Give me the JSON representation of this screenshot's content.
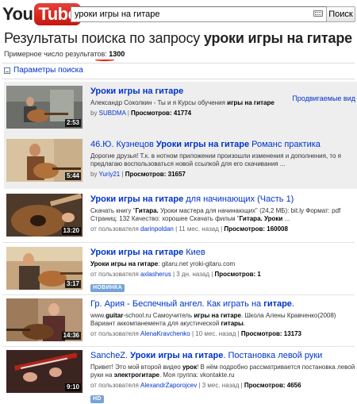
{
  "header": {
    "logo_you": "You",
    "logo_tube": "Tube",
    "search_value": "уроки игры на гитаре",
    "search_button": "Поиск"
  },
  "results": {
    "title_prefix": "Результаты поиска по запросу ",
    "query": "уроки игры на гитаре",
    "count_label": "Примерное число результатов: ",
    "count": "1300",
    "filter_label": "Параметры поиска",
    "promoted_label": "Продвигаемые вид"
  },
  "videos": [
    {
      "duration": "2:53",
      "title_a": "Уроки игры на гитаре",
      "title_b": "",
      "desc1_a": "Александр Соколкин - Ты и я Курсы обучения ",
      "desc1_b": "игры на гитаре",
      "desc2": "",
      "by_label": "by ",
      "user": "SUBDMA",
      "views_label": "Просмотров: 41774",
      "age": "",
      "badge": ""
    },
    {
      "duration": "5:44",
      "title_a": "46.Ю. Кузнецов ",
      "title_b": "Уроки игры на гитаре",
      "title_c": " Романс практика",
      "desc1": "Дорогие друзья! Т.к. в нотном приложении произошли изменения и дополнения, то я",
      "desc2": "предлагаю воспользоваться новой ссылкой для его скачивания ...",
      "by_label": "by ",
      "user": "Yuriy21",
      "views_label": "Просмотров: 31657"
    },
    {
      "duration": "13:20",
      "title_a": "Уроки игры на гитаре",
      "title_b": " для начинающих (Часть 1)",
      "desc1_a": "Скачать книгу \"",
      "desc1_b": "Гитара.",
      "desc1_c": " Уроки мастера для начинающих\" (24,2 МБ): bit.ly Формат: pdf",
      "desc2_a": "Страниц: 132 Качество: хорошее Скачать фильм \"",
      "desc2_b": "Гитара. Уроки",
      "desc2_c": " ...",
      "by_label": "от пользователя ",
      "user": "darinpoldan",
      "age": " | 11 мес. назад | ",
      "views_label": "Просмотров: 160008"
    },
    {
      "duration": "3:17",
      "title_a": "Уроки игры на гитаре",
      "title_b": " Киев",
      "desc1_a": "Уроки игры на гитаре",
      "desc1_b": ": gitaru.net yroki-gitaru.com",
      "by_label": "от пользователя ",
      "user": "axlasherus",
      "age": " | 3 дн. назад | ",
      "views_label": "Просмотров: 1",
      "badge": "НОВИНКА"
    },
    {
      "duration": "14:36",
      "title_a": "Гр. Ария - Беспечный ангел. Как играть на ",
      "title_b": "гитаре",
      "title_c": ".",
      "desc1_a": "www.",
      "desc1_b": "guitar",
      "desc1_c": "-school.ru Самоучитель ",
      "desc1_d": "игры на гитаре",
      "desc1_e": ". Школа Алены Кравченко(2008)",
      "desc2_a": "Вариант аккомпанемента для акустической ",
      "desc2_b": "гитары",
      "desc2_c": ".",
      "by_label": "от пользователя ",
      "user": "AlenaKravchenko",
      "age": " | 10 мес. назад | ",
      "views_label": "Просмотров: 13173"
    },
    {
      "duration": "9:10",
      "title_a": "SancheZ. ",
      "title_b": "Уроки игры на гитаре",
      "title_c": ". Постановка левой руки",
      "desc1_a": "Привет! Это мой второй видео ",
      "desc1_b": "урок",
      "desc1_c": "! В нём подробно рассматривается постановка левой",
      "desc2_a": "руки на ",
      "desc2_b": "электрогитаре",
      "desc2_c": ". Моя группа: vkontakte.ru",
      "by_label": "от пользователя ",
      "user": "AlexandrZaporojcev",
      "age": " | 3 мес. назад | ",
      "views_label": "Просмотров: 4656",
      "badge": "HD"
    }
  ]
}
